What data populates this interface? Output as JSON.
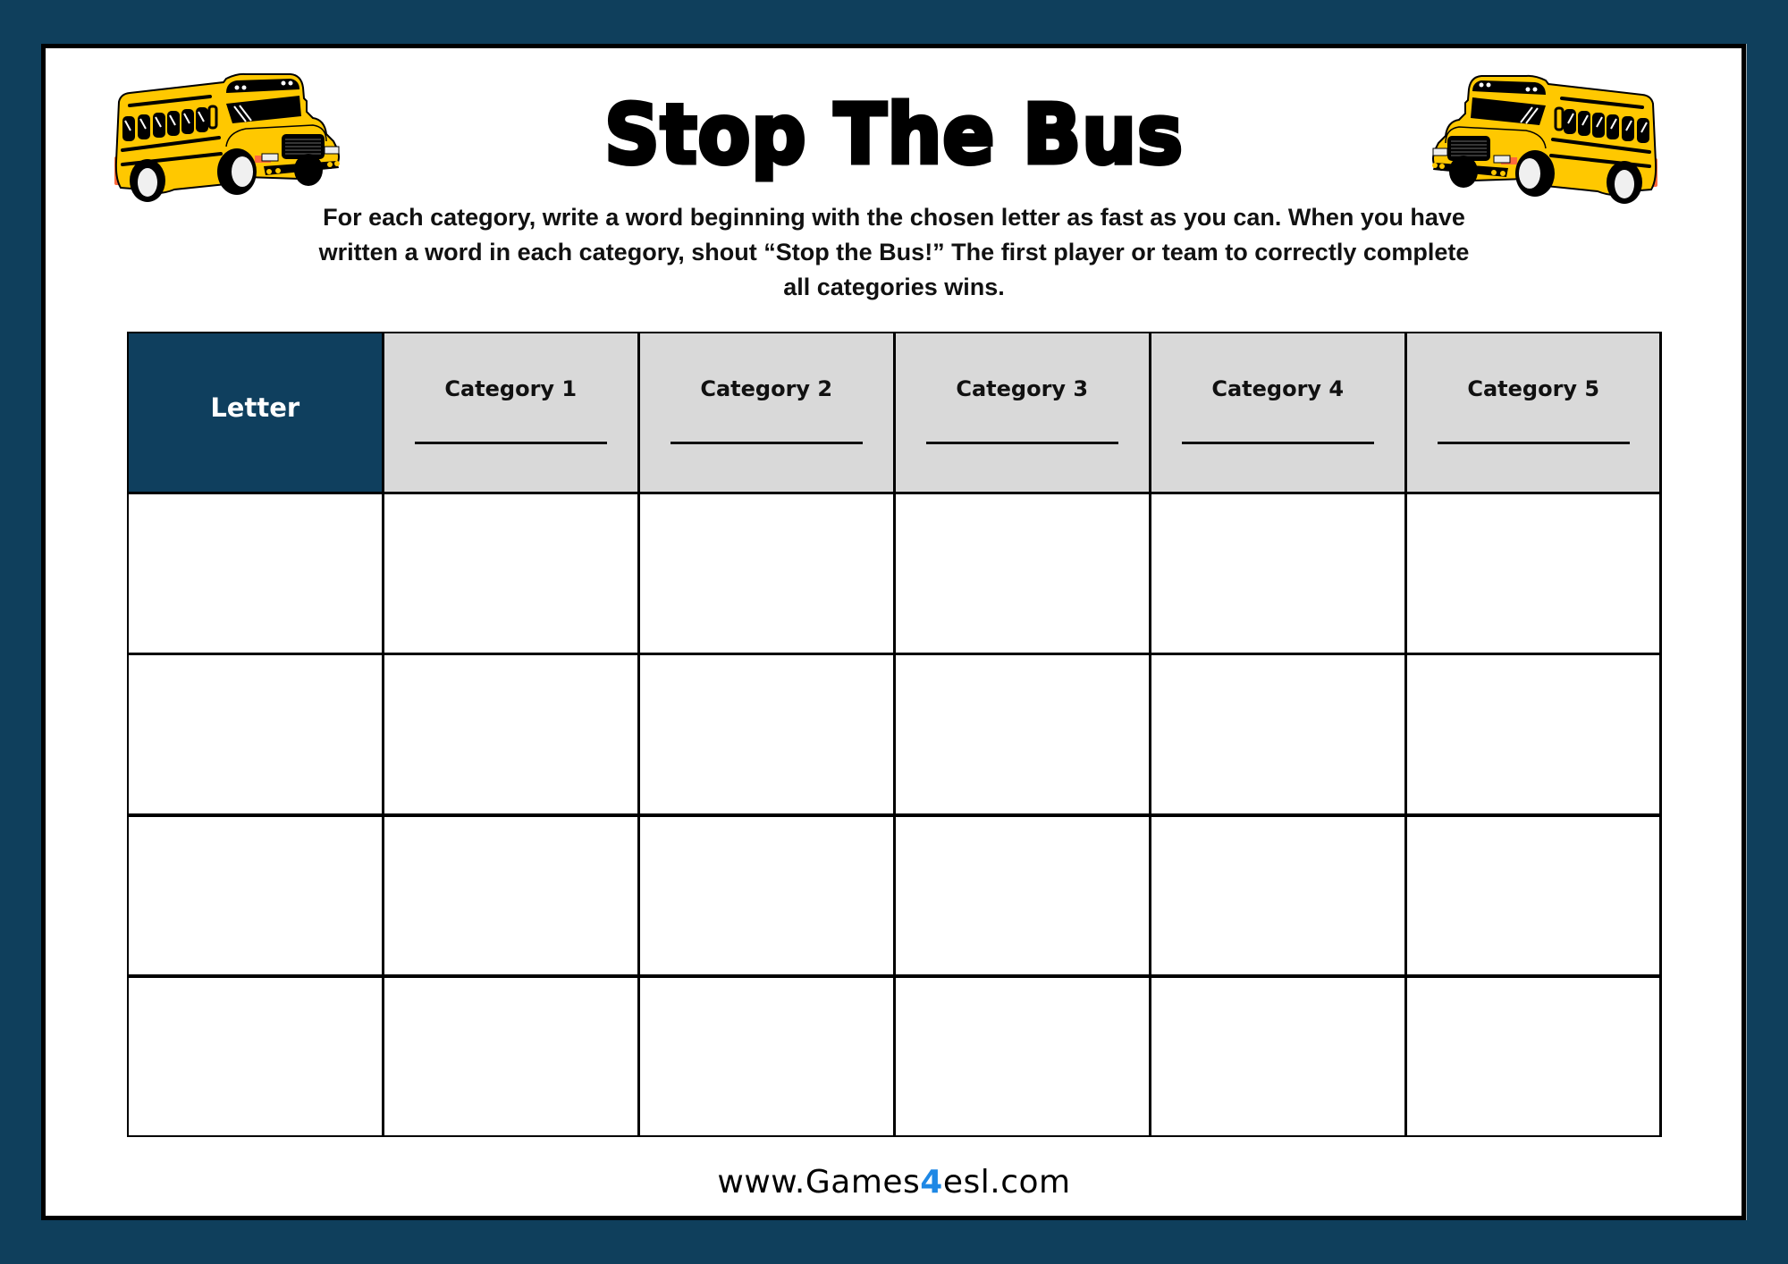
{
  "title": "Stop The Bus",
  "instructions": "For each category, write a word beginning with the chosen letter as fast as you can. When you have written a word in each category, shout “Stop the Bus!” The first player or team to correctly complete all categories wins.",
  "table": {
    "letter_header": "Letter",
    "categories": [
      "Category 1",
      "Category 2",
      "Category 3",
      "Category 4",
      "Category 5"
    ],
    "answer_rows": 4
  },
  "footer": {
    "prefix": "www.Games",
    "accent": "4",
    "suffix": "esl.com"
  },
  "icons": {
    "left": "school-bus-icon",
    "right": "school-bus-icon"
  },
  "colors": {
    "background": "#0f3f5c",
    "letter_header_fill": "#0f3f5e",
    "category_header_fill": "#d9d9d9",
    "bus_yellow": "#ffc800",
    "footer_accent": "#1e88e5"
  }
}
